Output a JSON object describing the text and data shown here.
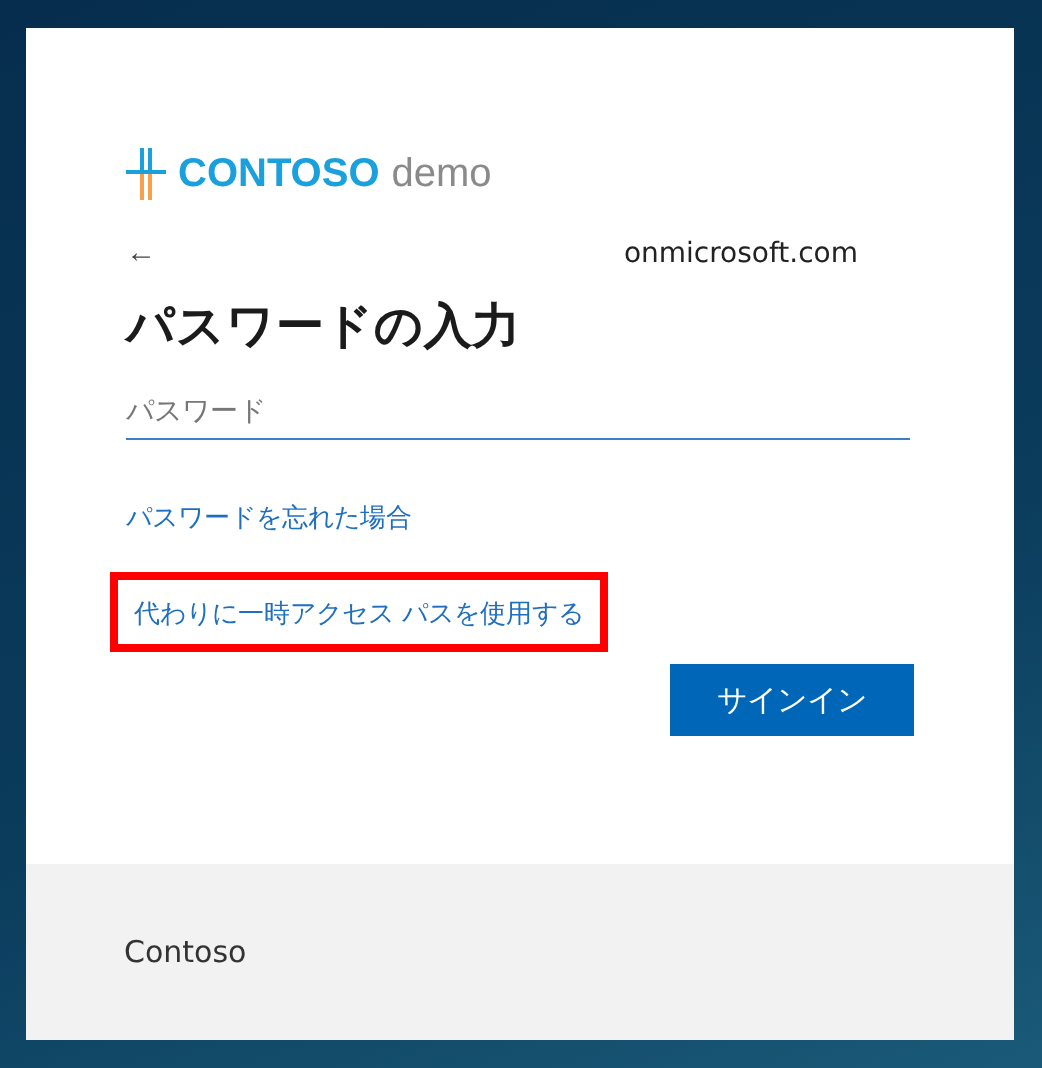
{
  "logo": {
    "brand": "CONTOSO",
    "suffix": "demo"
  },
  "header": {
    "back": "←",
    "account": "onmicrosoft.com"
  },
  "title": "パスワードの入力",
  "password_field": {
    "placeholder": "パスワード"
  },
  "links": [
    {
      "label": "パスワードを忘れた場合",
      "highlighted": false
    },
    {
      "label": "代わりに一時アクセス パスを使用する",
      "highlighted": true
    }
  ],
  "sign_in_button": "サインイン",
  "footer": {
    "text": "Contoso"
  }
}
